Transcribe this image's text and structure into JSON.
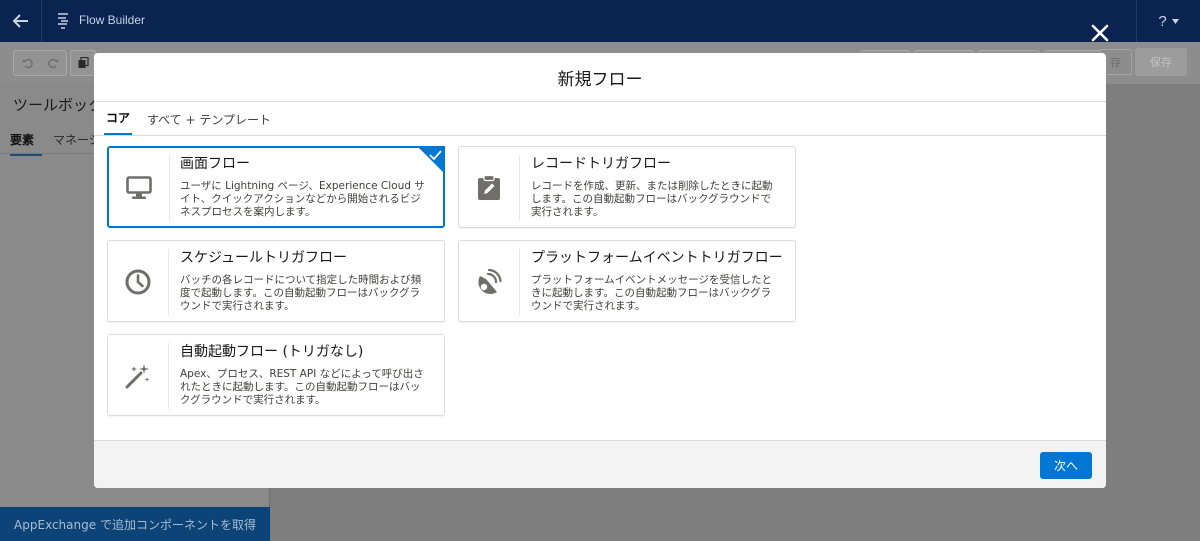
{
  "app": {
    "title": "Flow Builder",
    "help_label": "?"
  },
  "toolbar": {
    "save_label": "保存",
    "save_partial_label": "存"
  },
  "left_panel": {
    "title": "ツールボック",
    "tabs": [
      "要素",
      "マネージ"
    ],
    "appexchange_label": "AppExchange で追加コンポーネントを取得"
  },
  "modal": {
    "title": "新規フロー",
    "tabs": [
      {
        "label": "コア",
        "active": true
      },
      {
        "label": "すべて + テンプレート",
        "active": false
      }
    ],
    "cards": [
      {
        "title": "画面フロー",
        "description": "ユーザに Lightning ページ、Experience Cloud サイト、クイックアクションなどから開始されるビジネスプロセスを案内します。",
        "icon": "desktop-icon",
        "selected": true
      },
      {
        "title": "レコードトリガフロー",
        "description": "レコードを作成、更新、または削除したときに起動します。この自動起動フローはバックグラウンドで実行されます。",
        "icon": "clipboard-edit-icon",
        "selected": false
      },
      {
        "title": "スケジュールトリガフロー",
        "description": "バッチの各レコードについて指定した時間および頻度で起動します。この自動起動フローはバックグラウンドで実行されます。",
        "icon": "clock-icon",
        "selected": false
      },
      {
        "title": "プラットフォームイベントトリガフロー",
        "description": "プラットフォームイベントメッセージを受信したときに起動します。この自動起動フローはバックグラウンドで実行されます。",
        "icon": "broadcast-icon",
        "selected": false
      },
      {
        "title": "自動起動フロー (トリガなし)",
        "description": "Apex、プロセス、REST API などによって呼び出されたときに起動します。この自動起動フローはバックグラウンドで実行されます。",
        "icon": "magic-wand-icon",
        "selected": false
      }
    ],
    "next_label": "次へ"
  },
  "colors": {
    "brand": "#0176d3",
    "topbar": "#0a2351",
    "appexchange": "#0c4477"
  }
}
